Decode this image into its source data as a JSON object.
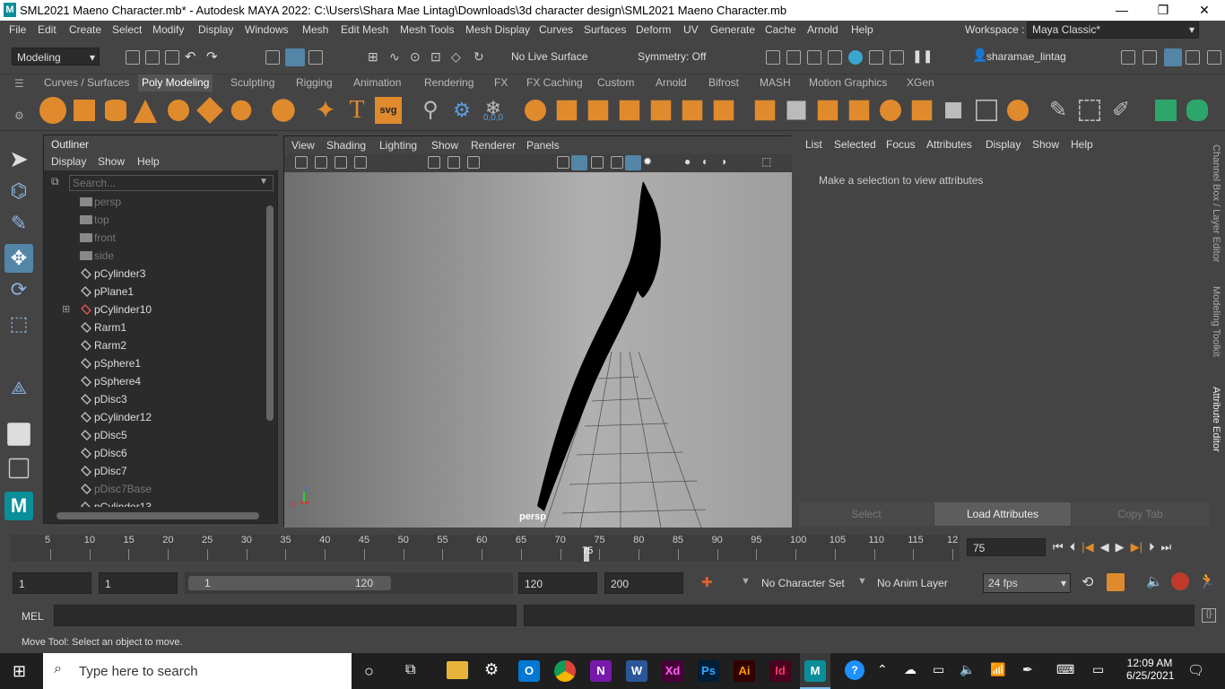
{
  "titlebar": {
    "title": "SML2021 Maeno Character.mb* - Autodesk MAYA 2022: C:\\Users\\Shara Mae Lintag\\Downloads\\3d character design\\SML2021 Maeno Character.mb",
    "minimize": "—",
    "maximize": "❐",
    "close": "✕"
  },
  "menu": [
    "File",
    "Edit",
    "Create",
    "Select",
    "Modify",
    "Display",
    "Windows",
    "Mesh",
    "Edit Mesh",
    "Mesh Tools",
    "Mesh Display",
    "Curves",
    "Surfaces",
    "Deform",
    "UV",
    "Generate",
    "Cache",
    "Arnold",
    "Help"
  ],
  "workspace": {
    "label": "Workspace :",
    "value": "Maya Classic*"
  },
  "statusline": {
    "mode": "Modeling",
    "live_surface": "No Live Surface",
    "symmetry": "Symmetry: Off",
    "user": "sharamae_lintag"
  },
  "shelf_tabs": [
    "Curves / Surfaces",
    "Poly Modeling",
    "Sculpting",
    "Rigging",
    "Animation",
    "Rendering",
    "FX",
    "FX Caching",
    "Custom",
    "Arnold",
    "Bifrost",
    "MASH",
    "Motion Graphics",
    "XGen"
  ],
  "shelf_active": "Poly Modeling",
  "shelf_icons": {
    "text_tool": "T",
    "svg_tool": "svg",
    "snow_label": "0,0,0"
  },
  "outliner": {
    "title": "Outliner",
    "menu": [
      "Display",
      "Show",
      "Help"
    ],
    "search_placeholder": "Search...",
    "items": [
      {
        "name": "persp",
        "type": "camera",
        "dim": true
      },
      {
        "name": "top",
        "type": "camera",
        "dim": true
      },
      {
        "name": "front",
        "type": "camera",
        "dim": true
      },
      {
        "name": "side",
        "type": "camera",
        "dim": true
      },
      {
        "name": "pCylinder3",
        "type": "mesh"
      },
      {
        "name": "pPlane1",
        "type": "mesh"
      },
      {
        "name": "pCylinder10",
        "type": "mesh",
        "expand": true
      },
      {
        "name": "Rarm1",
        "type": "mesh"
      },
      {
        "name": "Rarm2",
        "type": "mesh"
      },
      {
        "name": "pSphere1",
        "type": "mesh"
      },
      {
        "name": "pSphere4",
        "type": "mesh"
      },
      {
        "name": "pDisc3",
        "type": "mesh"
      },
      {
        "name": "pCylinder12",
        "type": "mesh"
      },
      {
        "name": "pDisc5",
        "type": "mesh"
      },
      {
        "name": "pDisc6",
        "type": "mesh"
      },
      {
        "name": "pDisc7",
        "type": "mesh"
      },
      {
        "name": "pDisc7Base",
        "type": "mesh",
        "dim": true
      },
      {
        "name": "pCylinder13",
        "type": "mesh"
      }
    ]
  },
  "viewport": {
    "menu": [
      "View",
      "Shading",
      "Lighting",
      "Show",
      "Renderer",
      "Panels"
    ],
    "camera_label": "persp",
    "axis_x": "x",
    "axis_z": "z"
  },
  "attribute_editor": {
    "menu": [
      "List",
      "Selected",
      "Focus",
      "Attributes",
      "Display",
      "Show",
      "Help"
    ],
    "message": "Make a selection to view attributes",
    "buttons": [
      "Select",
      "Load Attributes",
      "Copy Tab"
    ]
  },
  "side_tabs": [
    "Channel Box / Layer Editor",
    "Modeling Toolkit",
    "Attribute Editor"
  ],
  "timeline": {
    "ticks": [
      "5",
      "10",
      "15",
      "20",
      "25",
      "30",
      "35",
      "40",
      "45",
      "50",
      "55",
      "60",
      "65",
      "70",
      "75",
      "80",
      "85",
      "90",
      "95",
      "100",
      "105",
      "110",
      "115",
      "12"
    ],
    "current_frame": "75",
    "frame_field": "75",
    "current_fraction": 0.604
  },
  "range": {
    "start": "1",
    "playback_start": "1",
    "slider_start": "1",
    "slider_end": "120",
    "playback_end": "120",
    "end": "200",
    "character_set": "No Character Set",
    "anim_layer": "No Anim Layer",
    "fps": "24 fps"
  },
  "mel": {
    "label": "MEL"
  },
  "help_line": "Move Tool: Select an object to move.",
  "taskbar": {
    "search_placeholder": "Type here to search",
    "time": "12:09 AM",
    "date": "6/25/2021",
    "apps": [
      {
        "letter": "",
        "color": "#1e90ff"
      },
      {
        "letter": "",
        "color": "#0078d4"
      },
      {
        "letter": "N",
        "color": "#7719aa"
      },
      {
        "letter": "W",
        "color": "#2b579a"
      },
      {
        "letter": "Xd",
        "color": "#470137"
      },
      {
        "letter": "Ps",
        "color": "#001e36"
      },
      {
        "letter": "Ai",
        "color": "#330000"
      },
      {
        "letter": "Id",
        "color": "#49021f"
      },
      {
        "letter": "M",
        "color": "#0a8e9a"
      }
    ]
  },
  "colors": {
    "active_accent": "#5285a6",
    "maya_teal": "#0a8e9a",
    "shelf_orange": "#e08a2e"
  }
}
